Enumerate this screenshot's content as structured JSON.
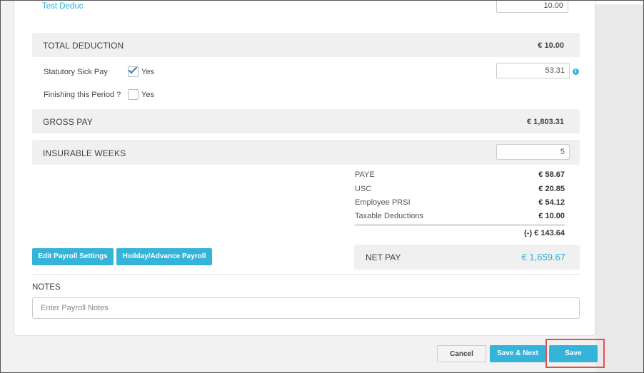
{
  "top_row": {
    "label": "Test Deduc",
    "value": "10.00"
  },
  "total_deduction": {
    "label": "TOTAL DEDUCTION",
    "value": "€ 10.00"
  },
  "statutory_sick_pay": {
    "label": "Statutory Sick Pay",
    "checkbox_label": "Yes",
    "checked": true,
    "value": "53.31",
    "info_icon": "i"
  },
  "finishing_period": {
    "label": "Finishing this Period ?",
    "checkbox_label": "Yes",
    "checked": false
  },
  "gross_pay": {
    "label": "GROSS PAY",
    "value": "€ 1,803.31"
  },
  "insurable_weeks": {
    "label": "INSURABLE WEEKS",
    "value": "5"
  },
  "summary": {
    "rows": [
      {
        "label": "PAYE",
        "value": "€ 58.67"
      },
      {
        "label": "USC",
        "value": "€ 20.85"
      },
      {
        "label": "Employee PRSI",
        "value": "€ 54.12"
      },
      {
        "label": "Taxable Deductions",
        "value": "€ 10.00"
      }
    ],
    "total": "(-)  € 143.64"
  },
  "buttons": {
    "edit_payroll_settings": "Edit Payroll Settings",
    "holiday_advance_payroll": "Hoilday/Advance Payroll",
    "cancel": "Cancel",
    "save_next": "Save & Next",
    "save": "Save"
  },
  "net_pay": {
    "label": "NET PAY",
    "value": "€ 1,659.67"
  },
  "notes": {
    "label": "NOTES",
    "placeholder": "Enter Payroll Notes"
  },
  "colors": {
    "accent": "#36b3d8",
    "highlight": "#e05252",
    "net_pay": "#2db2d9"
  }
}
